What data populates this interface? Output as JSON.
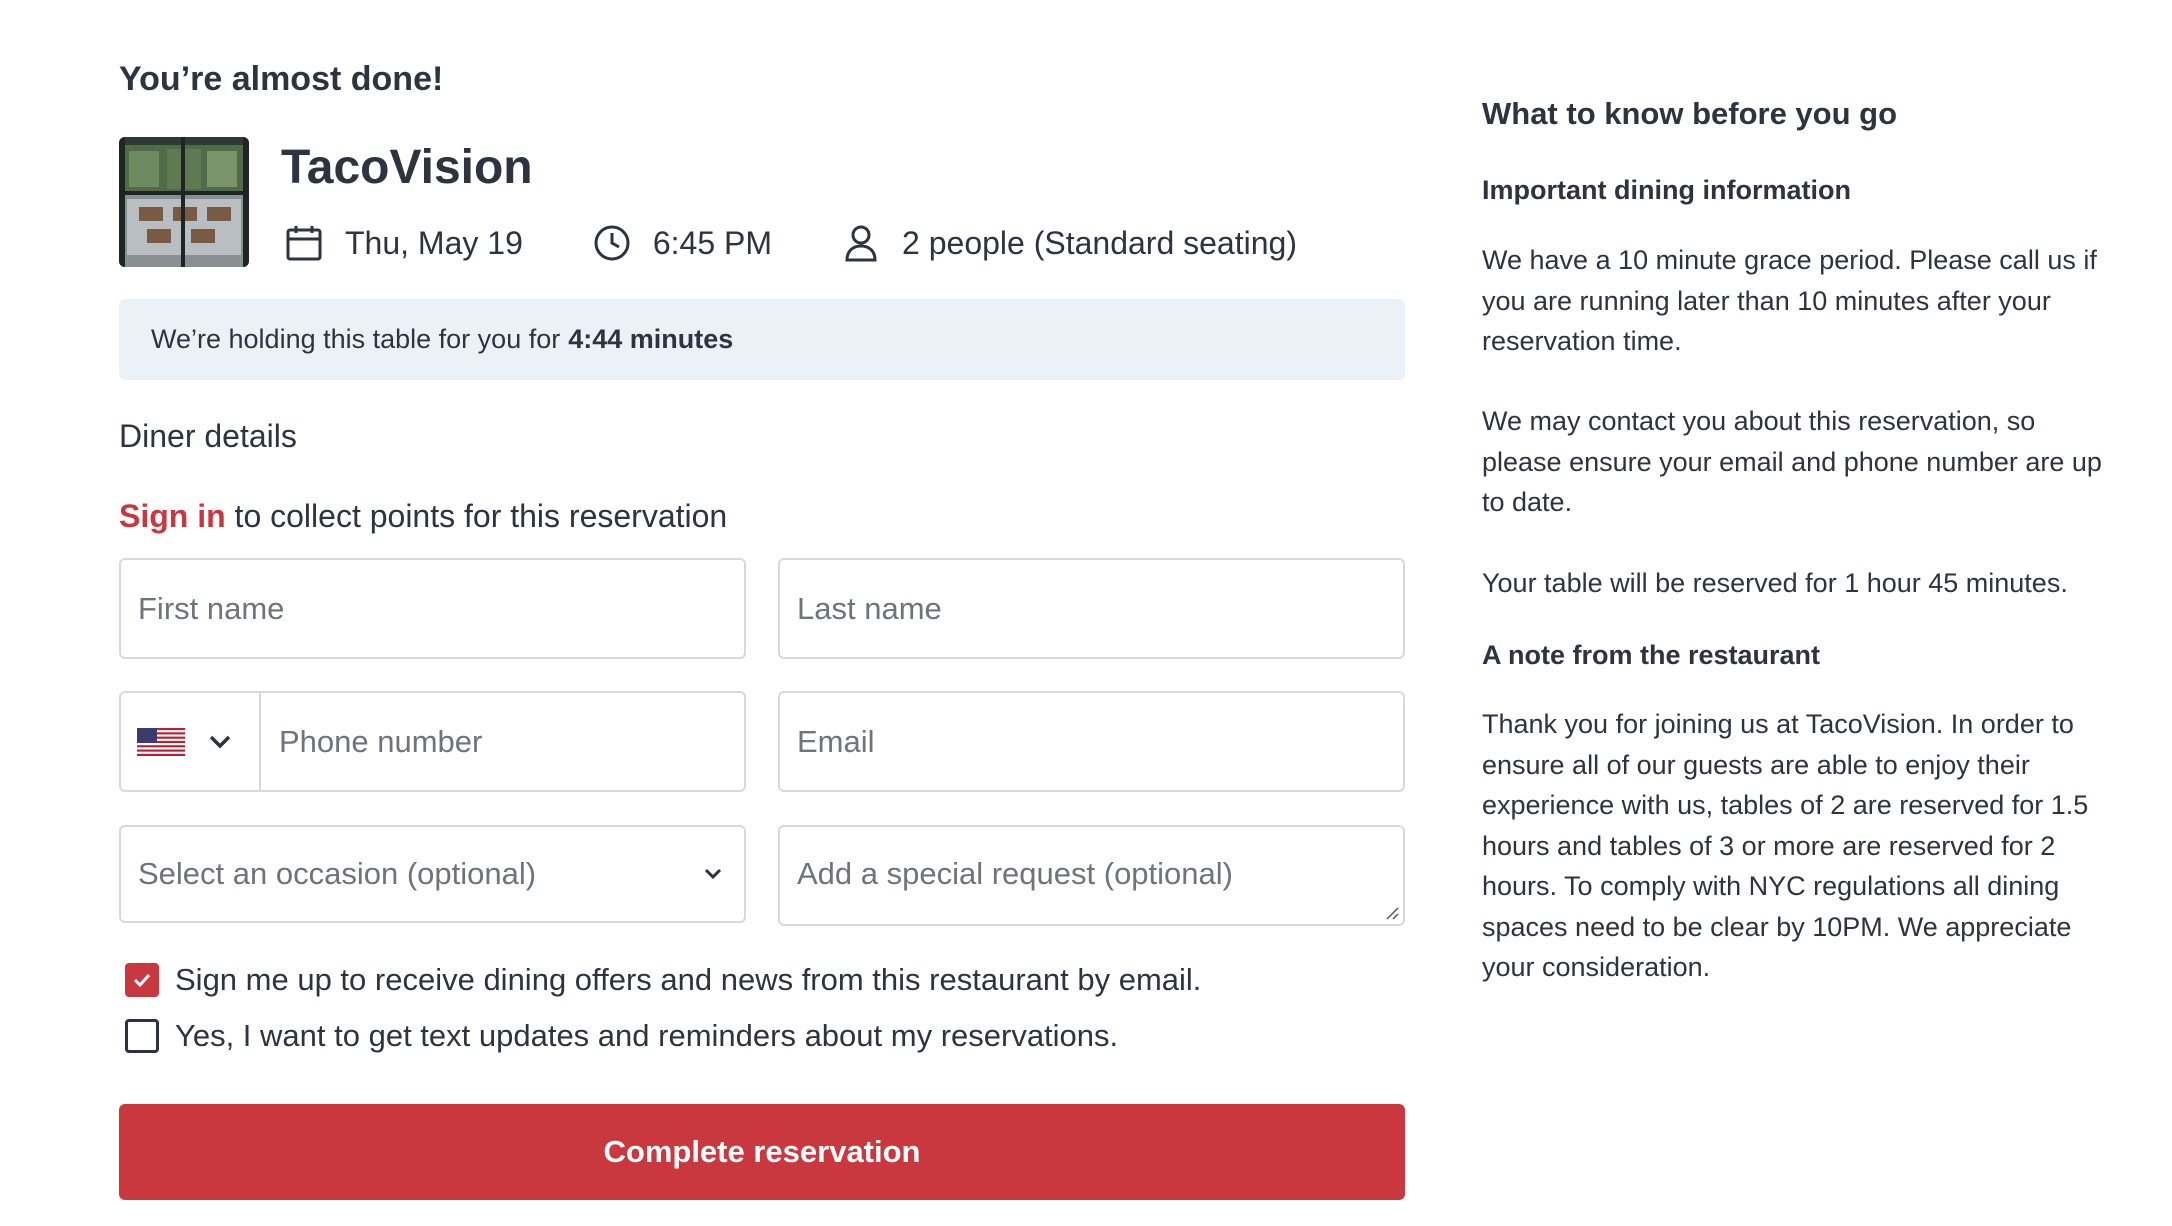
{
  "header": {
    "almost_done": "You’re almost done!"
  },
  "restaurant": {
    "name": "TacoVision",
    "date": "Thu, May 19",
    "time": "6:45 PM",
    "party": "2 people (Standard seating)"
  },
  "holding": {
    "text": "We’re holding this table for you for",
    "countdown": "4:44 minutes"
  },
  "form": {
    "section_title": "Diner details",
    "signin_link": "Sign in",
    "signin_text": " to collect points for this reservation",
    "first_name_placeholder": "First name",
    "last_name_placeholder": "Last name",
    "phone_placeholder": "Phone number",
    "email_placeholder": "Email",
    "occasion_placeholder": "Select an occasion (optional)",
    "request_placeholder": "Add a special request (optional)",
    "country_flag": "us-flag-icon",
    "checkbox_email_label": "Sign me up to receive dining offers and news from this restaurant by email.",
    "checkbox_email_checked": true,
    "checkbox_text_label": "Yes, I want to get text updates and reminders about my reservations.",
    "checkbox_text_checked": false,
    "submit_label": "Complete reservation"
  },
  "sidebar": {
    "title": "What to know before you go",
    "important_heading": "Important dining information",
    "important_p1": "We have a 10 minute grace period. Please call us if you are running later than 10 minutes after your reservation time.",
    "important_p2": "We may contact you about this reservation, so please ensure your email and phone number are up to date.",
    "important_p3": "Your table will be reserved for 1 hour 45 minutes.",
    "note_heading": "A note from the restaurant",
    "note_text": "Thank you for joining us at TacoVision. In order to ensure all of our guests are able to enjoy their experience with us, tables of 2 are reserved for 1.5 hours and tables of 3 or more are reserved for 2 hours. To comply with NYC regulations all dining spaces need to be clear by 10PM. We appreciate your consideration."
  },
  "colors": {
    "brand_red": "#c9383f",
    "text": "#2d333f",
    "holding_bg": "#ebf2f7",
    "border": "#d8d9db"
  }
}
